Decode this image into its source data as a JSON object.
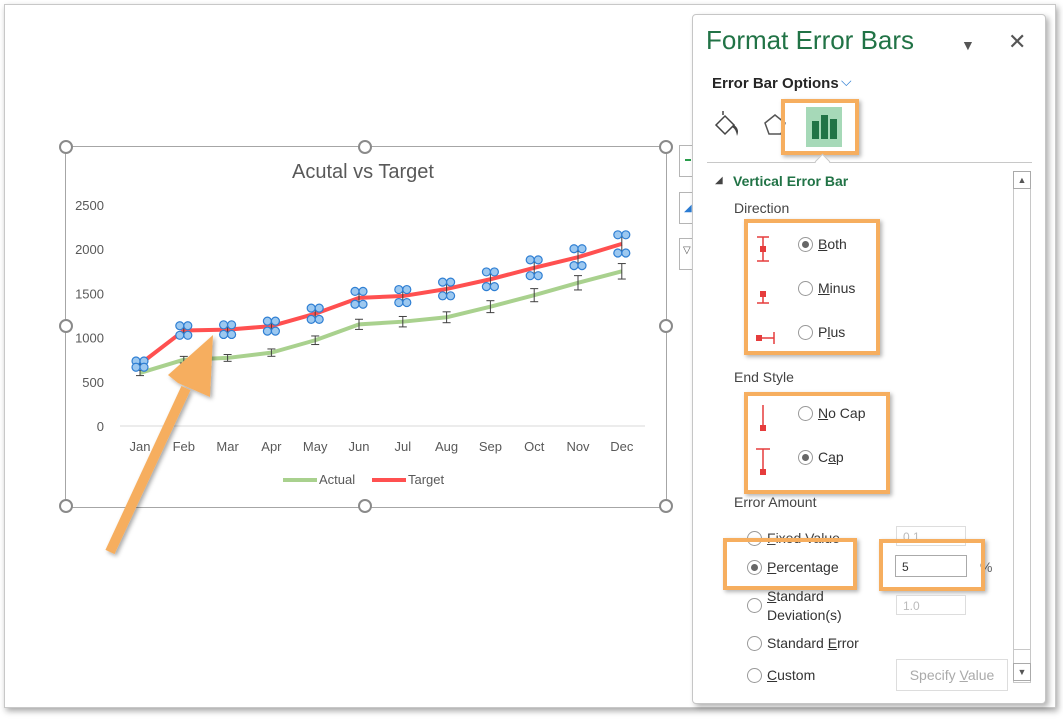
{
  "chart_data": {
    "type": "line",
    "title": "Acutal vs Target",
    "categories": [
      "Jan",
      "Feb",
      "Mar",
      "Apr",
      "May",
      "Jun",
      "Jul",
      "Aug",
      "Sep",
      "Oct",
      "Nov",
      "Dec"
    ],
    "series": [
      {
        "name": "Actual",
        "color": "#A9D18E",
        "values": [
          600,
          750,
          770,
          830,
          970,
          1150,
          1180,
          1230,
          1350,
          1480,
          1620,
          1750
        ],
        "error_bars": "percentage 5% both, cap"
      },
      {
        "name": "Target",
        "color": "#FF5050",
        "values": [
          700,
          1080,
          1090,
          1130,
          1270,
          1450,
          1470,
          1550,
          1660,
          1790,
          1910,
          2060
        ],
        "error_bars": "selected (handles shown)"
      }
    ],
    "yticks": [
      "0",
      "500",
      "1000",
      "1500",
      "2000",
      "2500"
    ],
    "ylim": [
      0,
      2500
    ],
    "xlabel": "",
    "ylabel": "",
    "legend": "bottom",
    "grid": false,
    "error_percent": 5
  },
  "annotation": {
    "arrow_color": "#F6AE5F",
    "highlight_color": "#F6AE5F"
  },
  "panel": {
    "title": "Format Error Bars",
    "menu_icon": "dropdown-triangle-icon",
    "close_icon": "close-icon",
    "options_label": "Error Bar Options",
    "tabs": [
      "fill-line-icon",
      "effects-pentagon-icon",
      "error-bar-options-icon"
    ],
    "section_title": "Vertical Error Bar",
    "direction": {
      "label": "Direction",
      "options": [
        {
          "pre": "",
          "key": "B",
          "post": "oth",
          "selected": true
        },
        {
          "pre": "",
          "key": "M",
          "post": "inus",
          "selected": false
        },
        {
          "pre": "P",
          "key": "l",
          "post": "us",
          "selected": false
        }
      ]
    },
    "end_style": {
      "label": "End Style",
      "options": [
        {
          "pre": "",
          "key": "N",
          "post": "o Cap",
          "selected": false
        },
        {
          "pre": "C",
          "key": "a",
          "post": "p",
          "selected": true
        }
      ]
    },
    "error_amount": {
      "label": "Error Amount",
      "fixed": {
        "pre": "",
        "key": "F",
        "post": "ixed Value",
        "value": "0.1"
      },
      "percentage": {
        "pre": "",
        "key": "P",
        "post": "ercentage",
        "value": "5",
        "unit": "%"
      },
      "stddev": {
        "pre": "",
        "key": "S",
        "post": "tandard",
        "line2": "Deviation(s)",
        "value": "1.0"
      },
      "stderr": {
        "pre": "Standard ",
        "key": "E",
        "post": "rror"
      },
      "custom": {
        "pre": "",
        "key": "C",
        "post": "ustom"
      },
      "specify_button": {
        "pre": "Specify ",
        "key": "V",
        "post": "alue"
      }
    }
  }
}
